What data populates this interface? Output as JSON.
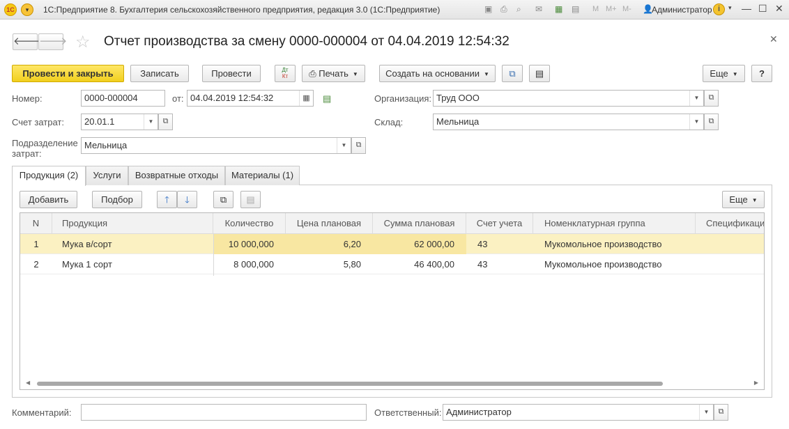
{
  "window": {
    "title": "1С:Предприятие 8. Бухгалтерия сельскохозяйственного предприятия, редакция 3.0  (1С:Предприятие)",
    "user": "Администратор",
    "memory_buttons": [
      "M",
      "M+",
      "M-"
    ],
    "icons": [
      "save-icon",
      "print-icon",
      "preview-icon",
      "mail-icon",
      "calculator-icon",
      "calendar-icon",
      "user-icon",
      "info-icon",
      "minimize-icon",
      "maximize-icon",
      "close-icon"
    ]
  },
  "document": {
    "title": "Отчет производства за смену 0000-000004 от 04.04.2019 12:54:32"
  },
  "toolbar": {
    "post_and_close": "Провести и закрыть",
    "save": "Записать",
    "post": "Провести",
    "dtkt_top": "Дт",
    "dtkt_bottom": "Кт",
    "print": "Печать",
    "create_based_on": "Создать на основании",
    "more": "Еще",
    "help": "?"
  },
  "form": {
    "number_label": "Номер:",
    "number_value": "0000-000004",
    "date_label": "от:",
    "date_value": "04.04.2019 12:54:32",
    "organization_label": "Организация:",
    "organization_value": "Труд ООО",
    "cost_account_label": "Счет затрат:",
    "cost_account_value": "20.01.1",
    "warehouse_label": "Склад:",
    "warehouse_value": "Мельница",
    "department_label_1": "Подразделение",
    "department_label_2": "затрат:",
    "department_value": "Мельница",
    "comment_label": "Комментарий:",
    "comment_value": "",
    "responsible_label": "Ответственный:",
    "responsible_value": "Администратор"
  },
  "tabs": [
    {
      "label": "Продукция (2)",
      "active": true
    },
    {
      "label": "Услуги",
      "active": false
    },
    {
      "label": "Возвратные отходы",
      "active": false
    },
    {
      "label": "Материалы (1)",
      "active": false
    }
  ],
  "table_toolbar": {
    "add": "Добавить",
    "pick": "Подбор",
    "more": "Еще"
  },
  "table": {
    "columns": [
      "N",
      "Продукция",
      "Количество",
      "Цена плановая",
      "Сумма плановая",
      "Счет учета",
      "Номенклатурная группа",
      "Спецификация"
    ],
    "rows": [
      {
        "n": "1",
        "product": "Мука в/сорт",
        "qty": "10 000,000",
        "price": "6,20",
        "sum": "62 000,00",
        "account": "43",
        "group": "Мукомольное производство",
        "spec": "",
        "selected": true
      },
      {
        "n": "2",
        "product": "Мука 1 сорт",
        "qty": "8 000,000",
        "price": "5,80",
        "sum": "46 400,00",
        "account": "43",
        "group": "Мукомольное производство",
        "spec": "",
        "selected": false
      }
    ]
  },
  "colors": {
    "primary_button": "#f5d42a",
    "selected_row": "#fbf1c2",
    "selected_cell": "#f8e7a2"
  }
}
